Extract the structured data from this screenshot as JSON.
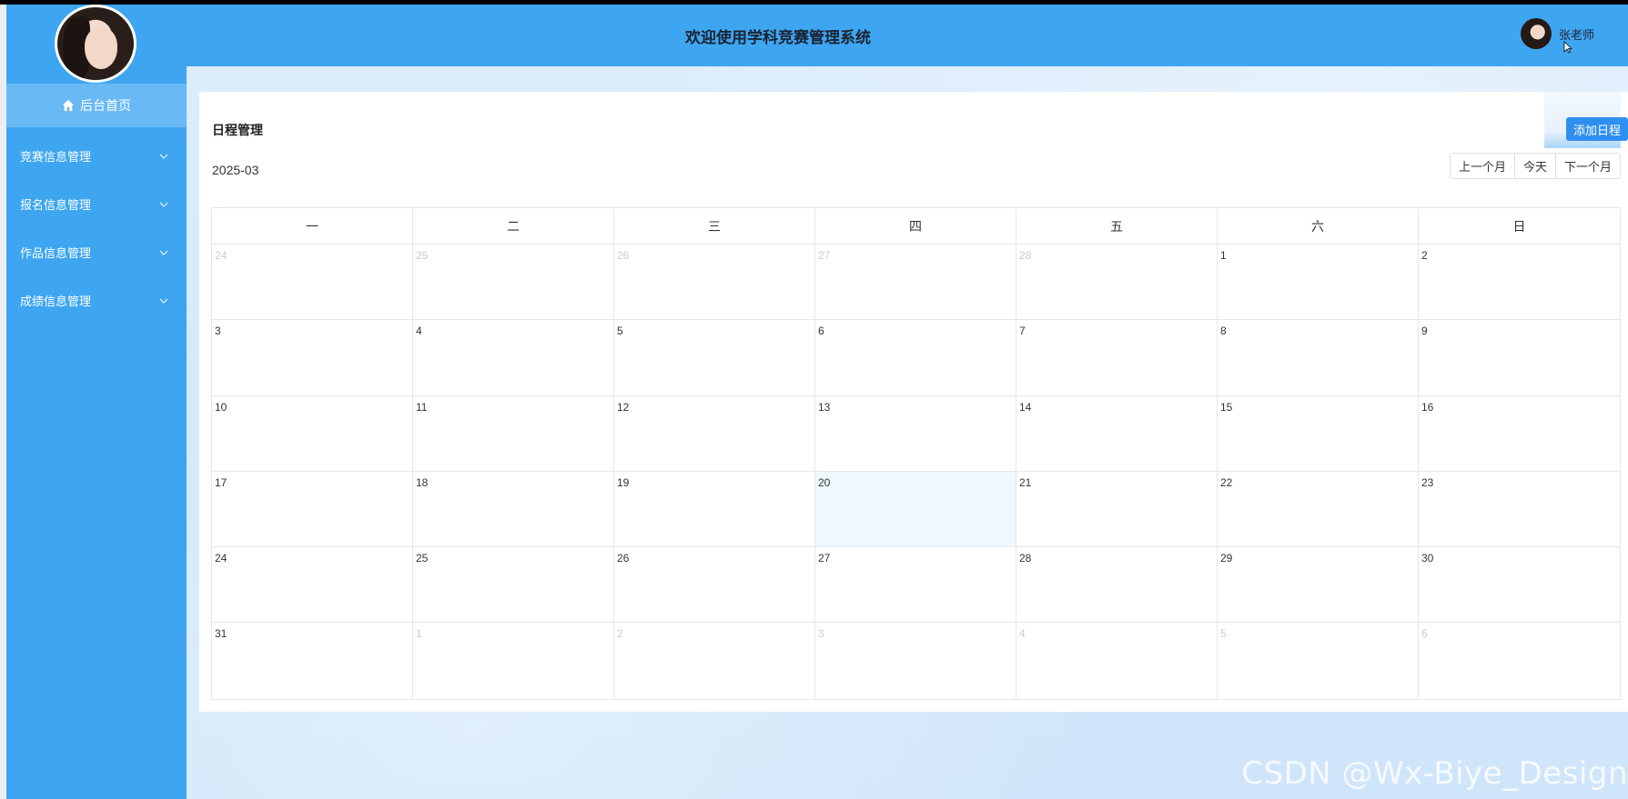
{
  "header": {
    "title": "欢迎使用学科竞赛管理系统",
    "user_name": "张老师"
  },
  "sidebar": {
    "home_label": "后台首页",
    "items": [
      {
        "label": "竞赛信息管理"
      },
      {
        "label": "报名信息管理"
      },
      {
        "label": "作品信息管理"
      },
      {
        "label": "成绩信息管理"
      }
    ]
  },
  "main": {
    "title": "日程管理",
    "add_label": "添加日程",
    "month": "2025-03",
    "nav": {
      "prev": "上一个月",
      "today": "今天",
      "next": "下一个月"
    },
    "weekdays": [
      "一",
      "二",
      "三",
      "四",
      "五",
      "六",
      "日"
    ],
    "days": [
      {
        "d": "24",
        "other": true
      },
      {
        "d": "25",
        "other": true
      },
      {
        "d": "26",
        "other": true
      },
      {
        "d": "27",
        "other": true
      },
      {
        "d": "28",
        "other": true
      },
      {
        "d": "1"
      },
      {
        "d": "2"
      },
      {
        "d": "3"
      },
      {
        "d": "4"
      },
      {
        "d": "5"
      },
      {
        "d": "6"
      },
      {
        "d": "7"
      },
      {
        "d": "8"
      },
      {
        "d": "9"
      },
      {
        "d": "10"
      },
      {
        "d": "11"
      },
      {
        "d": "12"
      },
      {
        "d": "13"
      },
      {
        "d": "14"
      },
      {
        "d": "15"
      },
      {
        "d": "16"
      },
      {
        "d": "17"
      },
      {
        "d": "18"
      },
      {
        "d": "19"
      },
      {
        "d": "20",
        "today": true
      },
      {
        "d": "21"
      },
      {
        "d": "22"
      },
      {
        "d": "23"
      },
      {
        "d": "24"
      },
      {
        "d": "25"
      },
      {
        "d": "26"
      },
      {
        "d": "27"
      },
      {
        "d": "28"
      },
      {
        "d": "29"
      },
      {
        "d": "30"
      },
      {
        "d": "31"
      },
      {
        "d": "1",
        "other": true
      },
      {
        "d": "2",
        "other": true
      },
      {
        "d": "3",
        "other": true
      },
      {
        "d": "4",
        "other": true
      },
      {
        "d": "5",
        "other": true
      },
      {
        "d": "6",
        "other": true
      }
    ]
  },
  "watermark": "CSDN @Wx-Biye_Design",
  "colors": {
    "primary": "#3ea6f1",
    "button": "#2f8ff0",
    "today_bg": "#eef9fd"
  }
}
